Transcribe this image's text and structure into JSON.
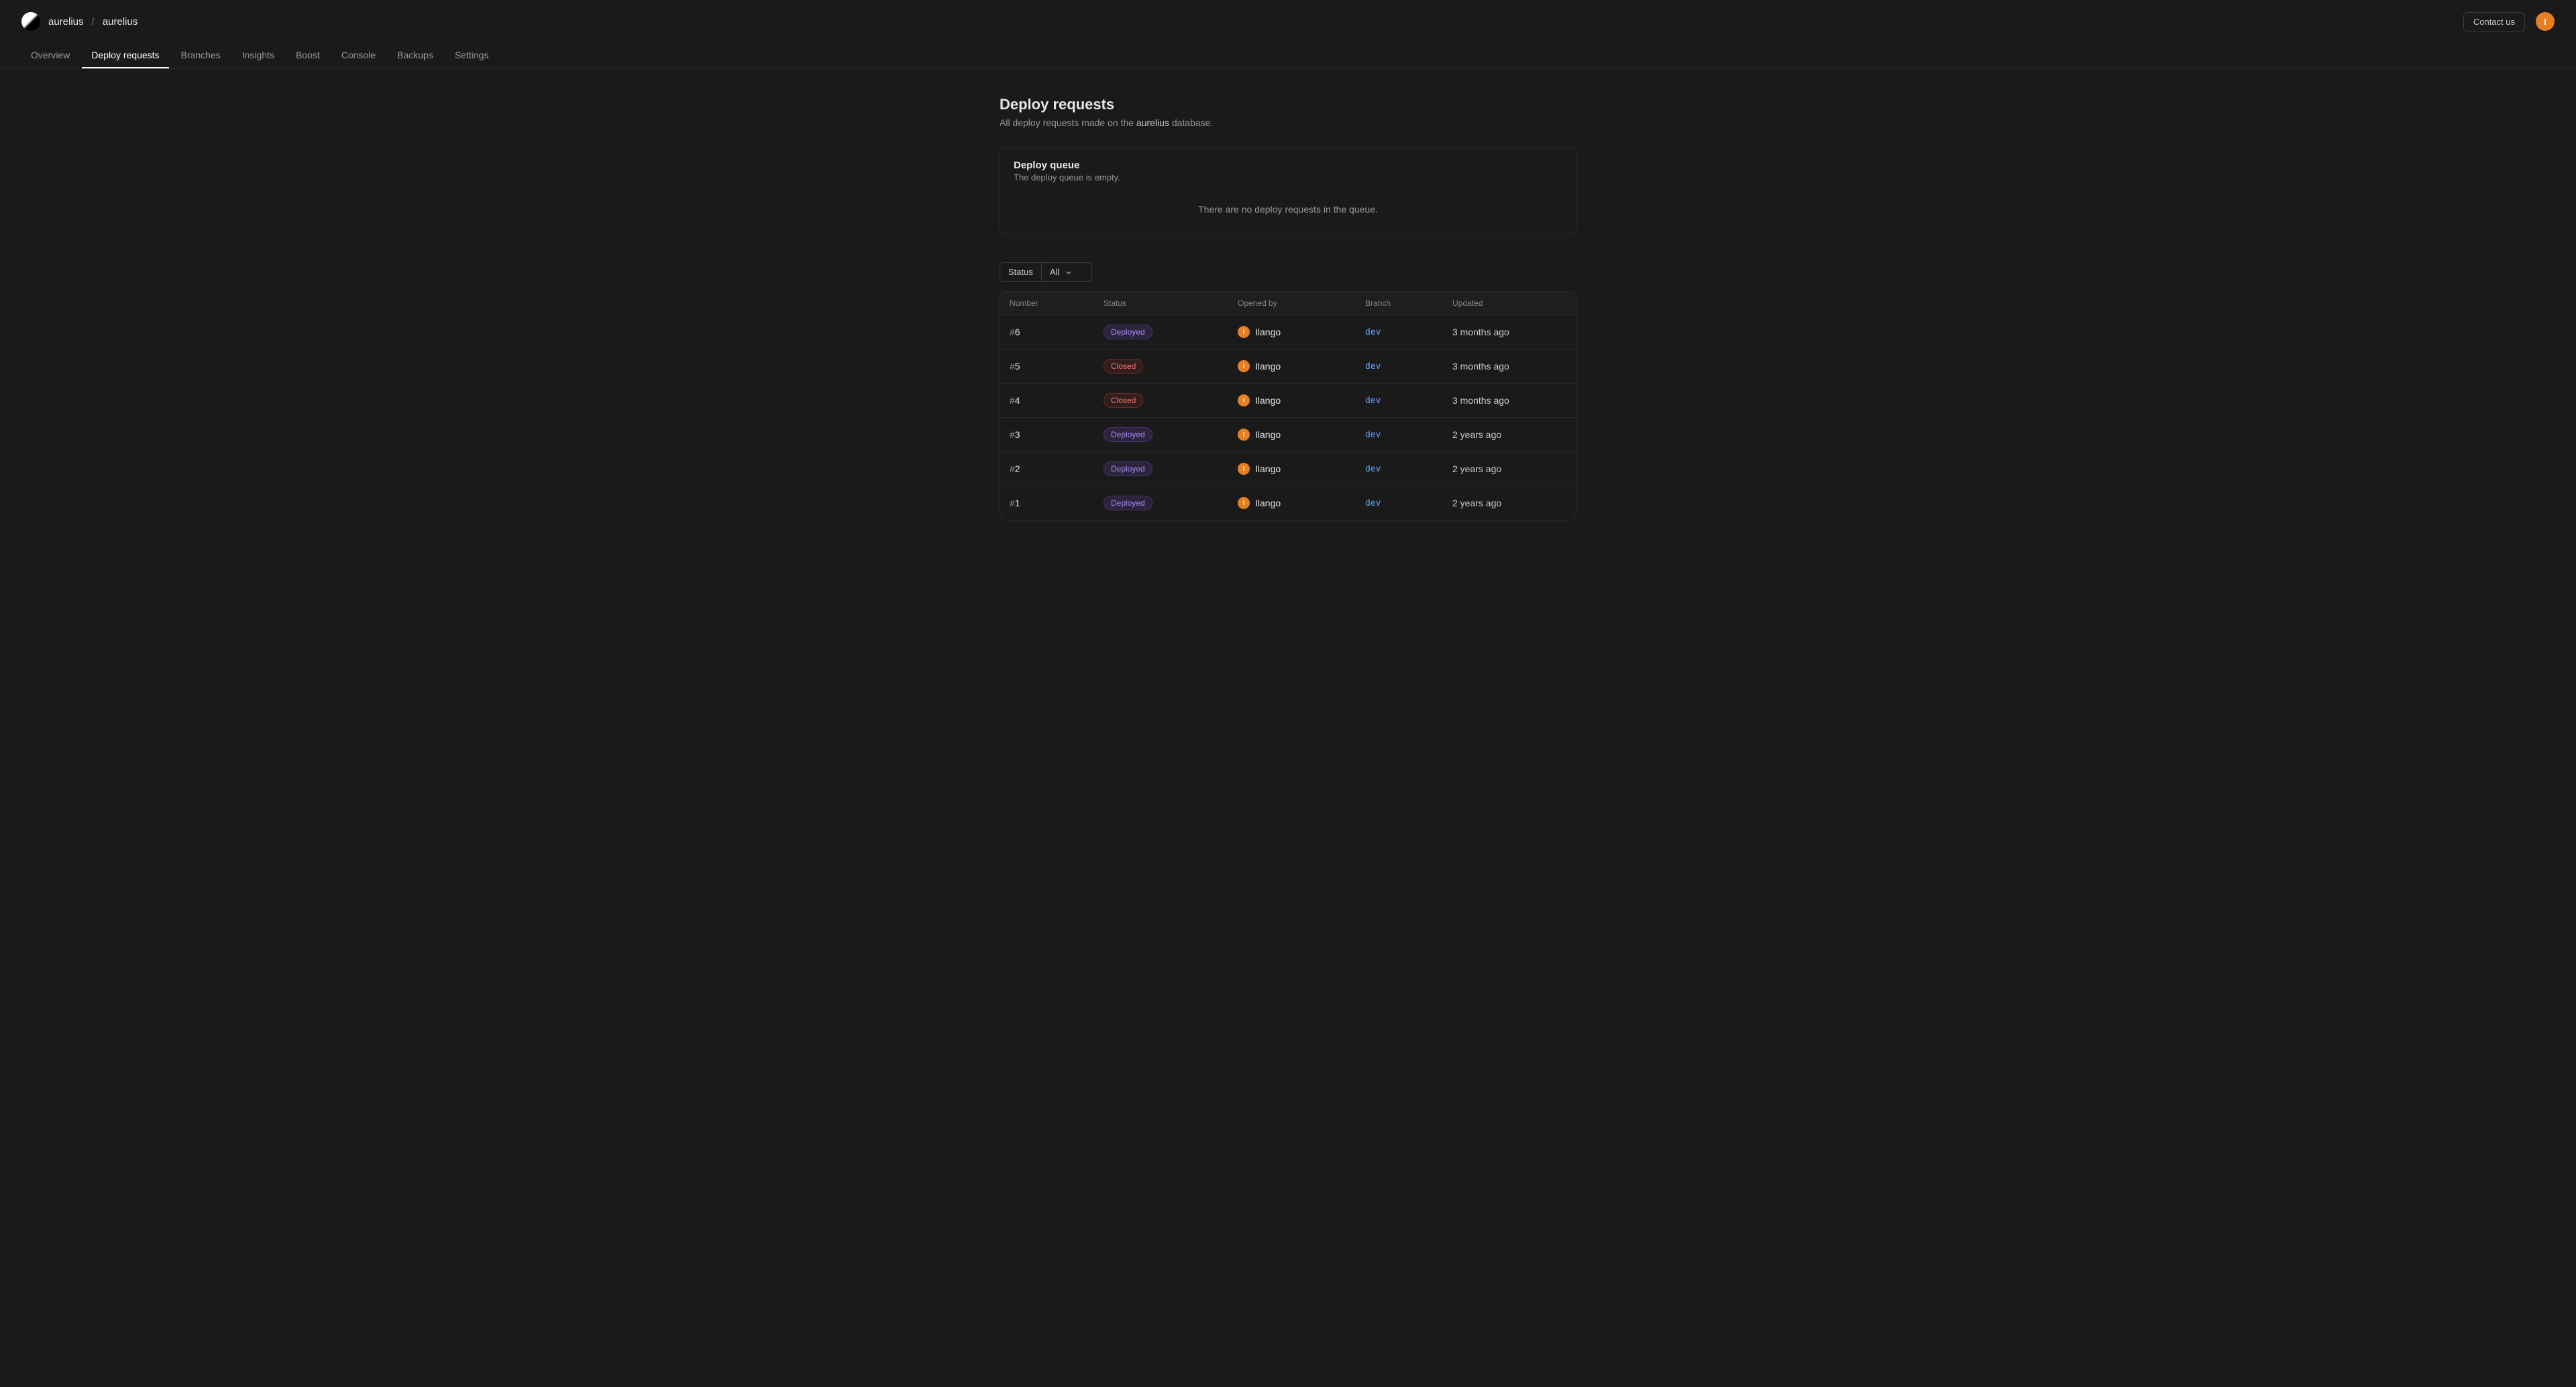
{
  "header": {
    "breadcrumb": [
      "aurelius",
      "aurelius"
    ],
    "contact_label": "Contact us",
    "avatar_initial": "I"
  },
  "tabs": [
    {
      "label": "Overview",
      "active": false
    },
    {
      "label": "Deploy requests",
      "active": true
    },
    {
      "label": "Branches",
      "active": false
    },
    {
      "label": "Insights",
      "active": false
    },
    {
      "label": "Boost",
      "active": false
    },
    {
      "label": "Console",
      "active": false
    },
    {
      "label": "Backups",
      "active": false
    },
    {
      "label": "Settings",
      "active": false
    }
  ],
  "page": {
    "title": "Deploy requests",
    "subtitle_prefix": "All deploy requests made on the ",
    "subtitle_db": "aurelius",
    "subtitle_suffix": " database."
  },
  "queue": {
    "title": "Deploy queue",
    "subtitle": "The deploy queue is empty.",
    "empty_message": "There are no deploy requests in the queue."
  },
  "filter": {
    "label": "Status",
    "selected": "All"
  },
  "table": {
    "columns": [
      "Number",
      "Status",
      "Opened by",
      "Branch",
      "Updated"
    ],
    "rows": [
      {
        "number": "6",
        "status": "Deployed",
        "status_class": "deployed",
        "user": "Ilango",
        "user_initial": "I",
        "branch": "dev",
        "updated": "3 months ago"
      },
      {
        "number": "5",
        "status": "Closed",
        "status_class": "closed",
        "user": "Ilango",
        "user_initial": "I",
        "branch": "dev",
        "updated": "3 months ago"
      },
      {
        "number": "4",
        "status": "Closed",
        "status_class": "closed",
        "user": "Ilango",
        "user_initial": "I",
        "branch": "dev",
        "updated": "3 months ago"
      },
      {
        "number": "3",
        "status": "Deployed",
        "status_class": "deployed",
        "user": "Ilango",
        "user_initial": "I",
        "branch": "dev",
        "updated": "2 years ago"
      },
      {
        "number": "2",
        "status": "Deployed",
        "status_class": "deployed",
        "user": "Ilango",
        "user_initial": "I",
        "branch": "dev",
        "updated": "2 years ago"
      },
      {
        "number": "1",
        "status": "Deployed",
        "status_class": "deployed",
        "user": "Ilango",
        "user_initial": "I",
        "branch": "dev",
        "updated": "2 years ago"
      }
    ]
  }
}
